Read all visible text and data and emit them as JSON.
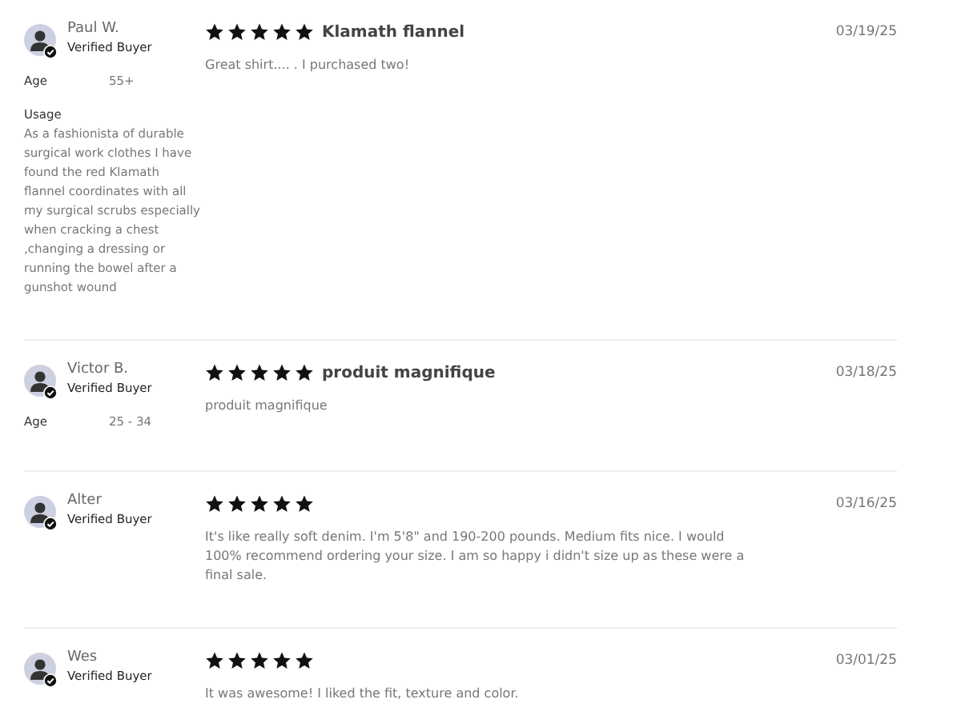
{
  "reviews": [
    {
      "name": "Paul W.",
      "badge": "Verified Buyer",
      "attributes": [
        {
          "label": "Age",
          "value": "55+",
          "kind": "inline"
        },
        {
          "label": "Usage",
          "value": "As a fashionista of durable surgical work clothes I have found the red Klamath flannel coordinates with all my surgical scrubs especially when cracking a chest ,changing a dressing or running the bowel after a gunshot wound",
          "kind": "block"
        }
      ],
      "stars": 5,
      "title": "Klamath flannel",
      "body": "Great shirt.... . I purchased two!",
      "date": "03/19/25"
    },
    {
      "name": "Victor B.",
      "badge": "Verified Buyer",
      "attributes": [
        {
          "label": "Age",
          "value": "25 - 34",
          "kind": "inline"
        }
      ],
      "stars": 5,
      "title": "produit magnifique",
      "body": "produit magnifique",
      "date": "03/18/25"
    },
    {
      "name": "Alter",
      "badge": "Verified Buyer",
      "stars": 5,
      "body": "It's like really soft denim. I'm 5'8\" and 190-200 pounds. Medium fits nice. I would 100% recommend ordering your size. I am so happy i didn't size up as these were a final sale.",
      "date": "03/16/25"
    },
    {
      "name": "Wes",
      "badge": "Verified Buyer",
      "stars": 5,
      "body": "It was awesome! I liked the fit, texture and color.",
      "date": "03/01/25"
    }
  ]
}
